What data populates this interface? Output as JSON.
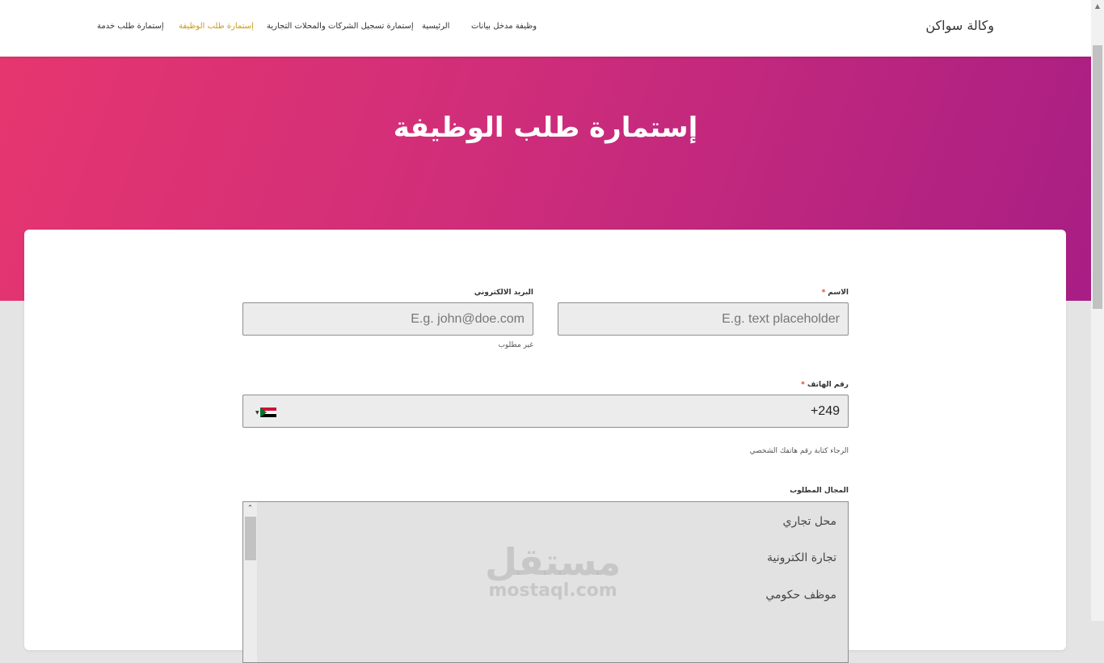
{
  "header": {
    "brand": "وكالة سواكن",
    "nav": [
      {
        "label": "وظيفة مدخل بيانات",
        "active": false
      },
      {
        "label": "الرئيسية",
        "active": false
      },
      {
        "label": "إستمارة تسجيل الشركات والمحلات التجارية",
        "active": false
      },
      {
        "label": "إستمارة طلب الوظيفة",
        "active": true
      },
      {
        "label": "إستمارة طلب خدمة",
        "active": false
      }
    ]
  },
  "hero": {
    "title": "إستمارة طلب الوظيفة"
  },
  "form": {
    "name": {
      "label": "الاسم",
      "required_mark": "*",
      "placeholder": "E.g. text placeholder"
    },
    "email": {
      "label": "البريد الالكتروني",
      "placeholder": "E.g. john@doe.com",
      "help": "غير مطلوب"
    },
    "phone": {
      "label": "رقم الهاتف",
      "required_mark": "*",
      "value": "+249",
      "help": "الرجاء كتابة رقم هاتفك الشخصي"
    },
    "field": {
      "label": "المجال المطلوب",
      "options": [
        "محل تجاري",
        "تجارة الكترونية",
        "موظف حكومي"
      ]
    }
  },
  "watermark": {
    "arabic": "مستقل",
    "latin": "mostaql.com"
  },
  "colors": {
    "hero_start": "#e6366f",
    "hero_end": "#a81e84",
    "active_nav": "#c99a1e",
    "required": "#e23b3b"
  }
}
